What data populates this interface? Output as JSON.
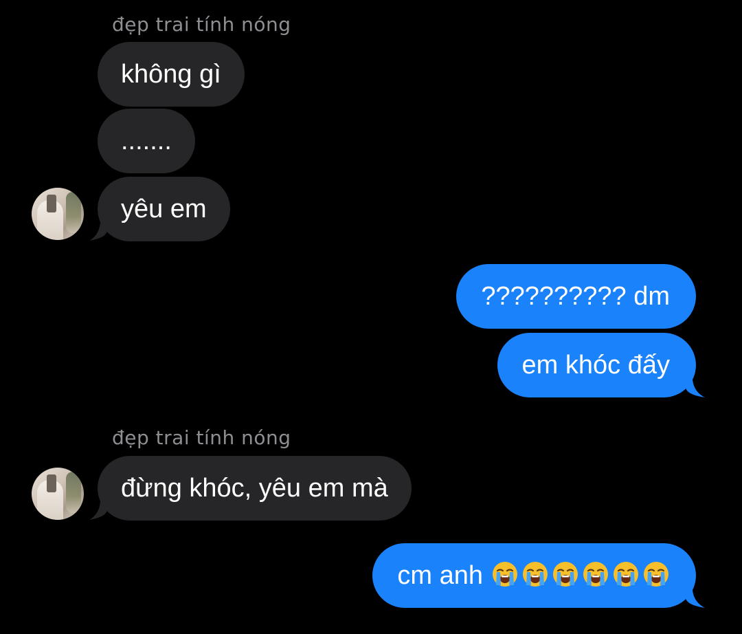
{
  "colors": {
    "background": "#000000",
    "incoming_bubble": "#262628",
    "outgoing_bubble": "#1a82fb",
    "sender_name": "#8e8e93"
  },
  "groups": [
    {
      "sender": "đẹp trai tính nóng",
      "messages": [
        "không gì",
        ".......",
        "yêu em"
      ]
    },
    {
      "sender": "",
      "messages": [
        "?????????? dm",
        "em khóc đấy"
      ]
    },
    {
      "sender": "đẹp trai tính nóng",
      "messages": [
        "đừng khóc, yêu em mà"
      ]
    },
    {
      "sender": "",
      "messages": [
        "cm anh"
      ]
    }
  ],
  "last_message_emojis": [
    "loudly-crying-face",
    "loudly-crying-face",
    "loudly-crying-face",
    "loudly-crying-face",
    "loudly-crying-face",
    "loudly-crying-face"
  ]
}
